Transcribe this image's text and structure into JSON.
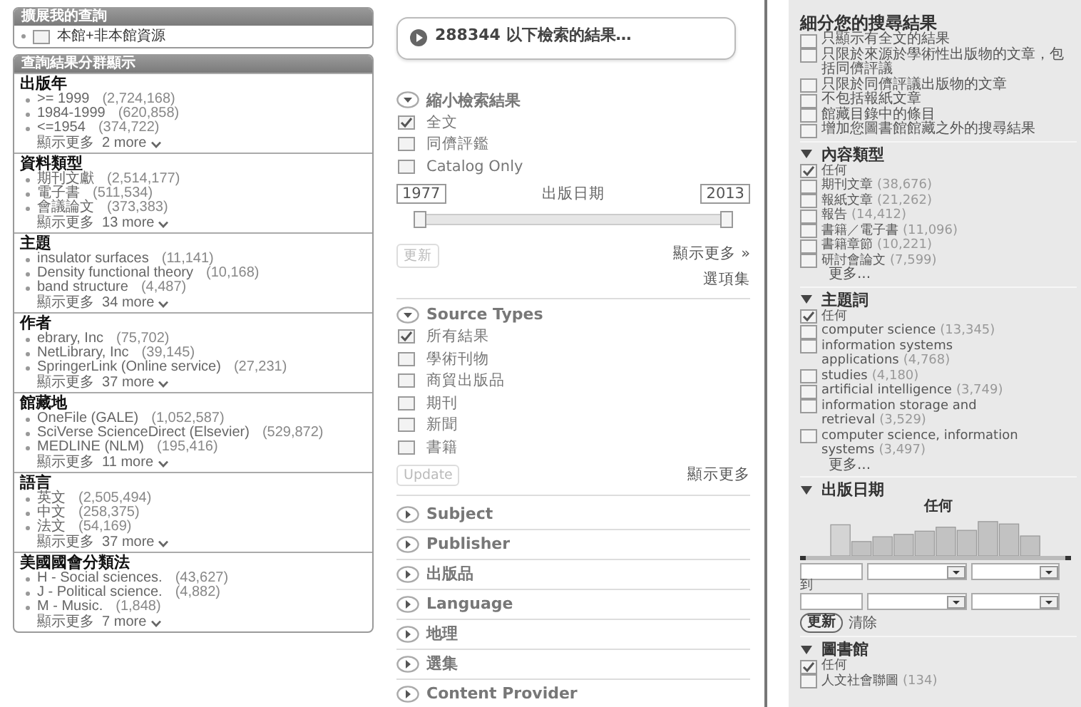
{
  "left": {
    "expand": {
      "title": "擴展我的查詢",
      "items": [
        {
          "label": "本館+非本館資源",
          "checked": false
        }
      ]
    },
    "clusters": {
      "title": "查詢結果分群顯示",
      "groups": [
        {
          "heading": "出版年",
          "items": [
            {
              "label": ">= 1999",
              "count": "(2,724,168)"
            },
            {
              "label": "1984-1999",
              "count": "(620,858)"
            },
            {
              "label": "<=1954",
              "count": "(374,722)"
            }
          ],
          "more_label": "顯示更多",
          "more_count": "2 more"
        },
        {
          "heading": "資料類型",
          "items": [
            {
              "label": "期刊文獻",
              "count": "(2,514,177)"
            },
            {
              "label": "電子書",
              "count": "(511,534)"
            },
            {
              "label": "會議論文",
              "count": "(373,383)"
            }
          ],
          "more_label": "顯示更多",
          "more_count": "13 more"
        },
        {
          "heading": "主題",
          "items": [
            {
              "label": "insulator surfaces",
              "count": "(11,141)"
            },
            {
              "label": "Density functional theory",
              "count": "(10,168)"
            },
            {
              "label": "band structure",
              "count": "(4,487)"
            }
          ],
          "more_label": "顯示更多",
          "more_count": "34 more"
        },
        {
          "heading": "作者",
          "items": [
            {
              "label": "ebrary, Inc",
              "count": "(75,702)"
            },
            {
              "label": "NetLibrary, Inc",
              "count": "(39,145)"
            },
            {
              "label": "SpringerLink (Online service)",
              "count": "(27,231)"
            }
          ],
          "more_label": "顯示更多",
          "more_count": "37 more"
        },
        {
          "heading": "館藏地",
          "items": [
            {
              "label": "OneFile (GALE)",
              "count": "(1,052,587)"
            },
            {
              "label": "SciVerse ScienceDirect (Elsevier)",
              "count": "(529,872)"
            },
            {
              "label": "MEDLINE (NLM)",
              "count": "(195,416)"
            }
          ],
          "more_label": "顯示更多",
          "more_count": "11 more"
        },
        {
          "heading": "語言",
          "items": [
            {
              "label": "英文",
              "count": "(2,505,494)"
            },
            {
              "label": "中文",
              "count": "(258,375)"
            },
            {
              "label": "法文",
              "count": "(54,169)"
            }
          ],
          "more_label": "顯示更多",
          "more_count": "37 more"
        },
        {
          "heading": "美國國會分類法",
          "items": [
            {
              "label": "H - Social sciences.",
              "count": "(43,627)"
            },
            {
              "label": "J - Political science.",
              "count": "(4,882)"
            },
            {
              "label": "M - Music.",
              "count": "(1,848)"
            }
          ],
          "more_label": "顯示更多",
          "more_count": "7 more"
        }
      ]
    }
  },
  "middle": {
    "result": "288344 以下檢索的結果…",
    "sections": [
      {
        "kind": "limits",
        "title": "縮小檢索結果",
        "expanded": true,
        "options": [
          {
            "label": "全文",
            "checked": true
          },
          {
            "label": "同儕評鑑",
            "checked": false
          },
          {
            "label": "Catalog Only",
            "checked": false
          }
        ],
        "date": {
          "from": "1977",
          "label": "出版日期",
          "to": "2013"
        },
        "slider": {
          "level": 1
        },
        "button": {
          "label": "更新",
          "disabled": true
        },
        "links": [
          "顯示更多 »",
          "選項集"
        ]
      },
      {
        "kind": "checklist",
        "title": "Source Types",
        "expanded": true,
        "options": [
          {
            "label": "所有結果",
            "checked": true
          },
          {
            "label": "學術刊物",
            "checked": false
          },
          {
            "label": "商貿出版品",
            "checked": false
          },
          {
            "label": "期刊",
            "checked": false
          },
          {
            "label": "新聞",
            "checked": false
          },
          {
            "label": "書籍",
            "checked": false
          }
        ],
        "button": {
          "label": "Update",
          "disabled": true
        },
        "links": [
          "顯示更多"
        ]
      },
      {
        "title": "Subject",
        "expanded": false
      },
      {
        "title": "Publisher",
        "expanded": false
      },
      {
        "title": "出版品",
        "expanded": false
      },
      {
        "title": "Language",
        "expanded": false
      },
      {
        "title": "地理",
        "expanded": false
      },
      {
        "title": "選集",
        "expanded": false
      },
      {
        "title": "Content Provider",
        "expanded": false
      }
    ]
  },
  "right": {
    "refine": {
      "title": "細分您的搜尋結果",
      "options": [
        {
          "label": "只顯示有全文的結果",
          "checked": false
        },
        {
          "label": "只限於來源於學術性出版物的文章，包括同儕評議",
          "checked": false
        },
        {
          "label": "只限於同儕評議出版物的文章",
          "checked": false
        },
        {
          "label": "不包括報紙文章",
          "checked": false
        },
        {
          "label": "館藏目錄中的條目",
          "checked": false
        },
        {
          "label": "增加您圖書館館藏之外的搜尋結果",
          "checked": false
        }
      ]
    },
    "facets": [
      {
        "kind": "checklist",
        "title": "內容類型",
        "expanded": true,
        "items": [
          {
            "label": "任何",
            "checked": true
          },
          {
            "label": "期刊文章",
            "count": "(38,676)",
            "checked": false
          },
          {
            "label": "報紙文章",
            "count": "(21,262)",
            "checked": false
          },
          {
            "label": "報告",
            "count": "(14,412)",
            "checked": false
          },
          {
            "label": "書籍／電子書",
            "count": "(11,096)",
            "checked": false
          },
          {
            "label": "書籍章節",
            "count": "(10,221)",
            "checked": false
          },
          {
            "label": "研討會論文",
            "count": "(7,599)",
            "checked": false
          }
        ],
        "more": "更多..."
      },
      {
        "kind": "checklist",
        "title": "主題詞",
        "expanded": true,
        "items": [
          {
            "label": "任何",
            "checked": true
          },
          {
            "label": "computer science",
            "count": "(13,345)",
            "checked": false
          },
          {
            "label": "information systems applications",
            "count": "(4,768)",
            "checked": false
          },
          {
            "label": "studies",
            "count": "(4,180)",
            "checked": false
          },
          {
            "label": "artificial intelligence",
            "count": "(3,749)",
            "checked": false
          },
          {
            "label": "information storage and retrieval",
            "count": "(3,529)",
            "checked": false
          },
          {
            "label": "computer science, information systems",
            "count": "(3,497)",
            "checked": false
          }
        ],
        "more": "更多..."
      },
      {
        "kind": "date",
        "title": "出版日期",
        "expanded": true,
        "range_label": "任何",
        "slider": {
          "level": 1
        },
        "to_label": "到",
        "button": "更新",
        "clear": "清除"
      },
      {
        "kind": "checklist",
        "title": "圖書館",
        "expanded": true,
        "items": [
          {
            "label": "任何",
            "checked": true
          },
          {
            "label": "人文社會聯圖",
            "count": "(134)",
            "checked": false
          }
        ]
      }
    ]
  }
}
